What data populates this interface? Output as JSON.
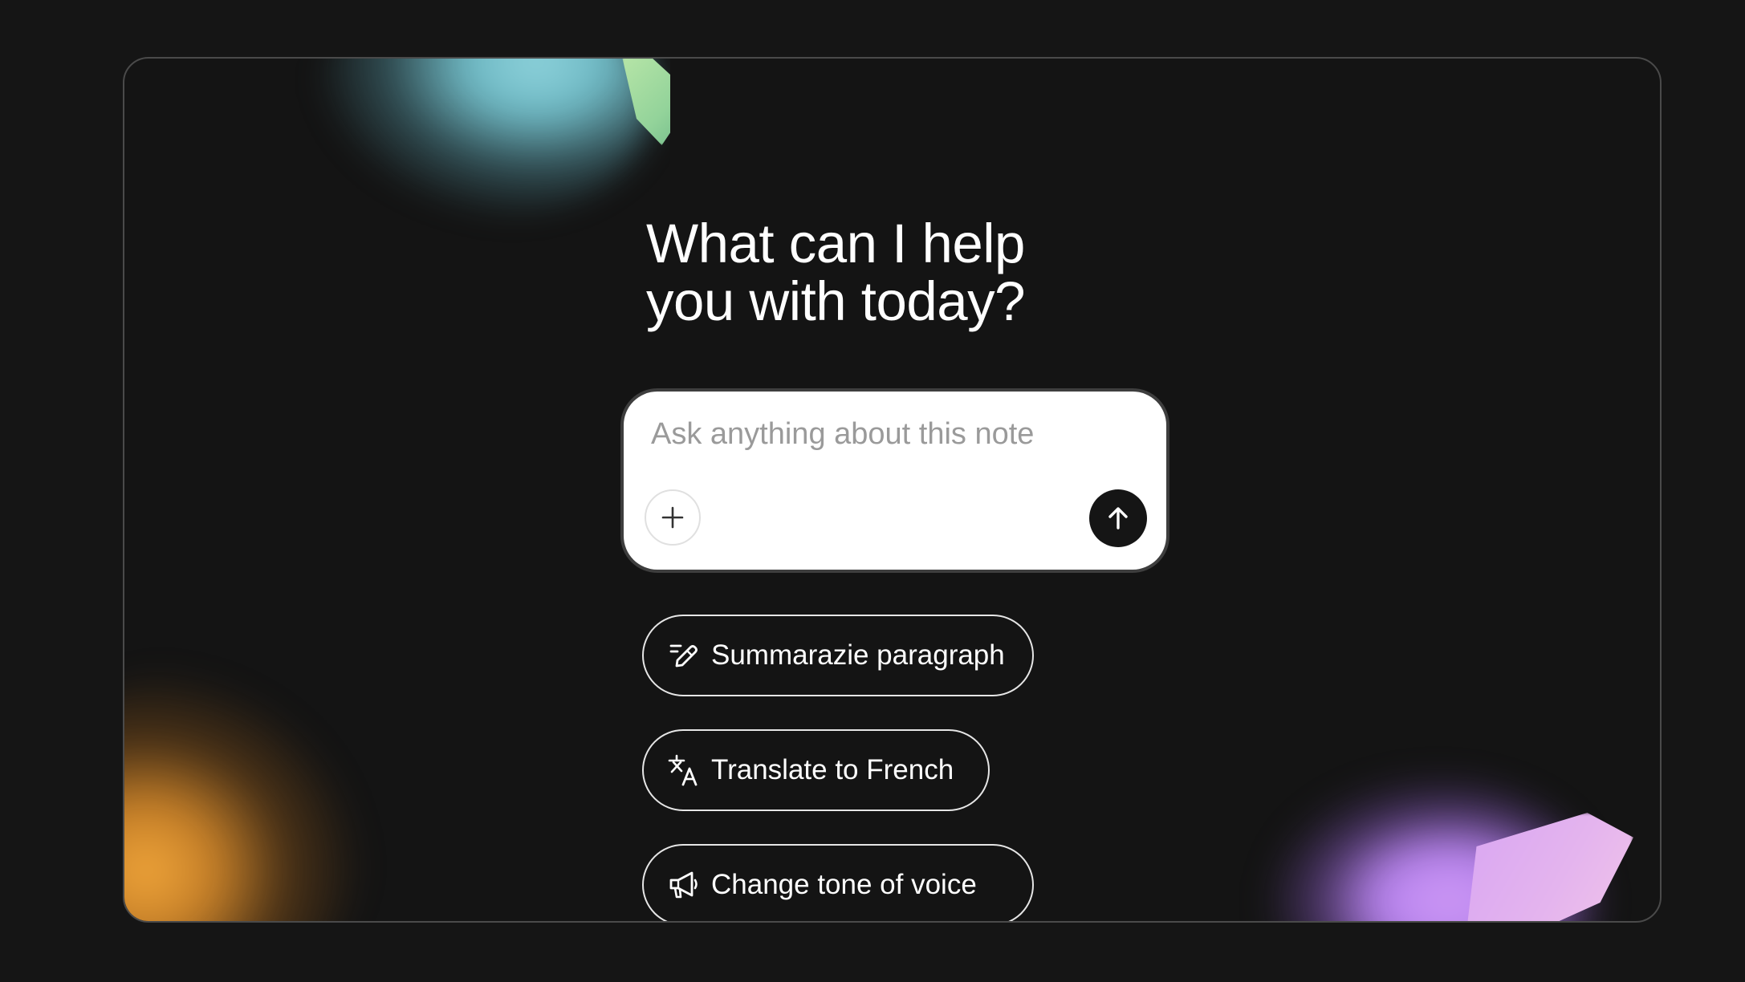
{
  "headline": {
    "line1": "What can I help",
    "line2": "you with today?"
  },
  "ask": {
    "placeholder": "Ask anything about this note",
    "value": "",
    "add_icon": "plus-icon",
    "send_icon": "arrow-up-icon"
  },
  "suggestions": [
    {
      "label": "Summarazie paragraph",
      "icon": "edit-lines-icon"
    },
    {
      "label": "Translate to French",
      "icon": "translate-icon"
    },
    {
      "label": "Change tone of voice",
      "icon": "megaphone-icon"
    }
  ],
  "colors": {
    "background": "#151515",
    "frame_border": "#4a4a4a",
    "text": "#ffffff",
    "input_bg": "#ffffff",
    "send_button": "#151515",
    "blob_teal": "#8fd3dc",
    "blob_green": "#a6dc9f",
    "blob_orange": "#f0a53a",
    "blob_purple": "#c893f3"
  }
}
